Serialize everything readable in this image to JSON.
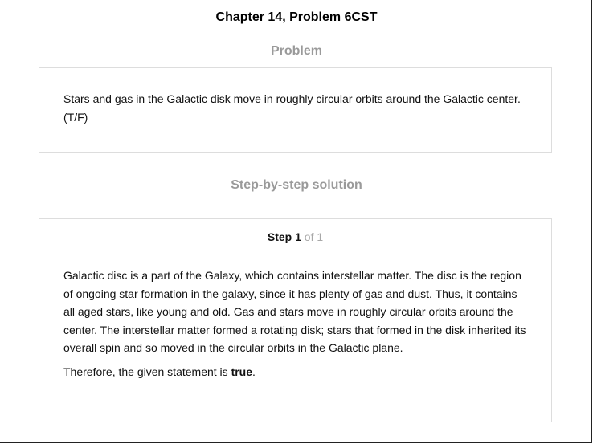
{
  "page": {
    "chapter_title": "Chapter 14, Problem 6CST"
  },
  "problem": {
    "heading": "Problem",
    "text": "Stars and gas in the Galactic disk move in roughly circular orbits around the Galactic center. (T/F)"
  },
  "solution": {
    "heading": "Step-by-step solution",
    "step": {
      "word": "Step",
      "number": "1",
      "of_text": "of 1"
    },
    "explanation": "Galactic disc is a part of the Galaxy, which contains interstellar matter. The disc is the region of ongoing star formation in the galaxy, since it has plenty of gas and dust. Thus, it contains all aged stars, like young and old. Gas and stars move in roughly circular orbits around the center. The interstellar matter formed a rotating disk; stars that formed in the disk inherited its overall spin and so moved in the circular orbits in the Galactic plane.",
    "conclusion_prefix": "Therefore, the given statement is",
    "conclusion_answer": "true",
    "conclusion_suffix": "."
  },
  "colors": {
    "heading_gray": "#9a9a9a",
    "border": "#dddddd",
    "text": "#111111"
  }
}
